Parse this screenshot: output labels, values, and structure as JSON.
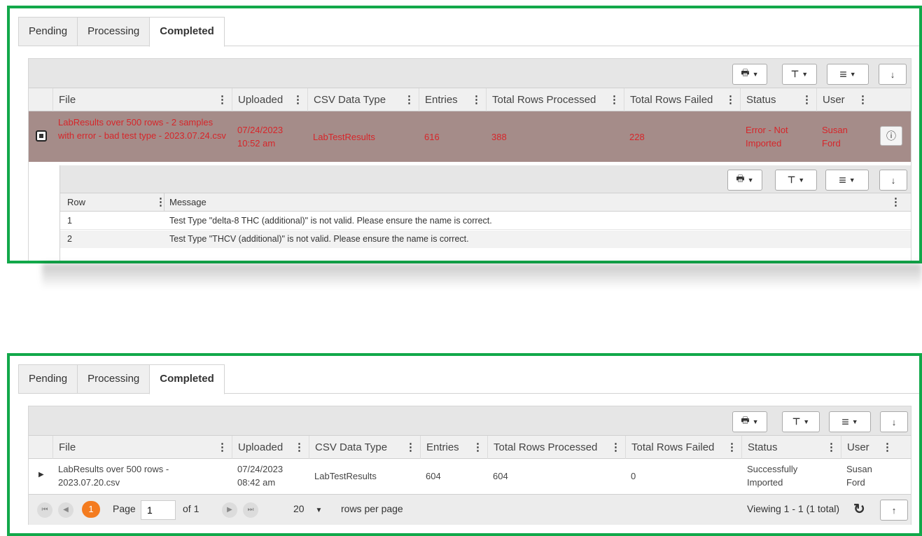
{
  "tabs": [
    "Pending",
    "Processing",
    "Completed"
  ],
  "toolbar": {
    "print_icon": "printer-icon",
    "filter_icon": "filter-icon",
    "columns_icon": "columns-menu-icon",
    "download_icon": "download-arrow-icon"
  },
  "columns": [
    "File",
    "Uploaded",
    "CSV Data Type",
    "Entries",
    "Total Rows Processed",
    "Total Rows Failed",
    "Status",
    "User"
  ],
  "panel1": {
    "row": {
      "file": "LabResults over 500 rows - 2 samples with error - bad test type - 2023.07.24.csv",
      "uploaded": "07/24/2023 10:52 am",
      "csv_type": "LabTestResults",
      "entries": "616",
      "processed": "388",
      "failed": "228",
      "status": "Error - Not Imported",
      "user": "Susan Ford"
    },
    "detail": {
      "columns": [
        "Row",
        "Message"
      ],
      "rows": [
        {
          "row": "1",
          "message": "Test Type \"delta-8 THC (additional)\" is not valid. Please ensure the name is correct."
        },
        {
          "row": "2",
          "message": "Test Type \"THCV (additional)\" is not valid. Please ensure the name is correct."
        }
      ]
    }
  },
  "panel2": {
    "row": {
      "file": "LabResults over 500 rows - 2023.07.20.csv",
      "uploaded": "07/24/2023 08:42 am",
      "csv_type": "LabTestResults",
      "entries": "604",
      "processed": "604",
      "failed": "0",
      "status": "Successfully Imported",
      "user": "Susan Ford"
    },
    "pager": {
      "current_page": "1",
      "page_label": "Page",
      "page_input": "1",
      "of_label": "of 1",
      "page_size": "20",
      "rows_per_page": "rows per page",
      "viewing": "Viewing 1 - 1 (1 total)"
    }
  },
  "colors": {
    "border_accent": "#12a84a",
    "error_text": "#d6262a",
    "error_row_bg": "#a58c89",
    "page_badge": "#f47c20"
  }
}
